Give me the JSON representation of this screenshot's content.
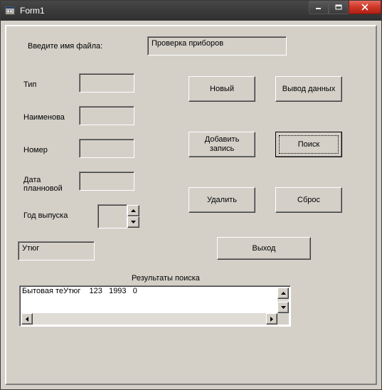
{
  "window": {
    "title": "Form1"
  },
  "labels": {
    "filename_prompt": "Введите имя файла:",
    "type": "Тип",
    "name": "Наименова",
    "number": "Номер",
    "planned_date": "Дата\nпланновой",
    "year": "Год выпуска",
    "search_results": "Результаты поиска"
  },
  "fields": {
    "filename_value": "Проверка приборов",
    "type_value": "",
    "name_value": "",
    "number_value": "",
    "date_value": "",
    "year_value": "",
    "search_key": "Утюг"
  },
  "buttons": {
    "new": "Новый",
    "output": "Вывод данных",
    "add_record": "Добавить\nзапись",
    "search": "Поиск",
    "delete": "Удалить",
    "reset": "Сброс",
    "exit": "Выход"
  },
  "results": {
    "rows": [
      "Бытовая теУтюг    123   1993   0"
    ]
  }
}
